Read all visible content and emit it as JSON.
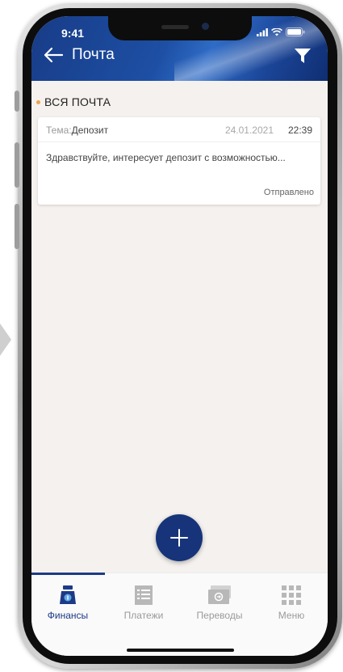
{
  "status_bar": {
    "time": "9:41"
  },
  "header": {
    "title": "Почта"
  },
  "section": {
    "label": "ВСЯ ПОЧТА"
  },
  "messages": [
    {
      "subject_label": "Тема:",
      "subject": "Депозит",
      "date": "24.01.2021",
      "time": "22:39",
      "preview": "Здравствуйте, интересует депозит с возможностью...",
      "status": "Отправлено"
    }
  ],
  "nav": {
    "items": [
      {
        "label": "Финансы",
        "icon": "finance-icon",
        "active": true
      },
      {
        "label": "Платежи",
        "icon": "payments-icon",
        "active": false
      },
      {
        "label": "Переводы",
        "icon": "transfers-icon",
        "active": false
      },
      {
        "label": "Меню",
        "icon": "menu-grid-icon",
        "active": false
      }
    ]
  },
  "colors": {
    "brand": "#1c3a86",
    "accent_dot": "#f0a34a",
    "background": "#f4f1ee"
  }
}
